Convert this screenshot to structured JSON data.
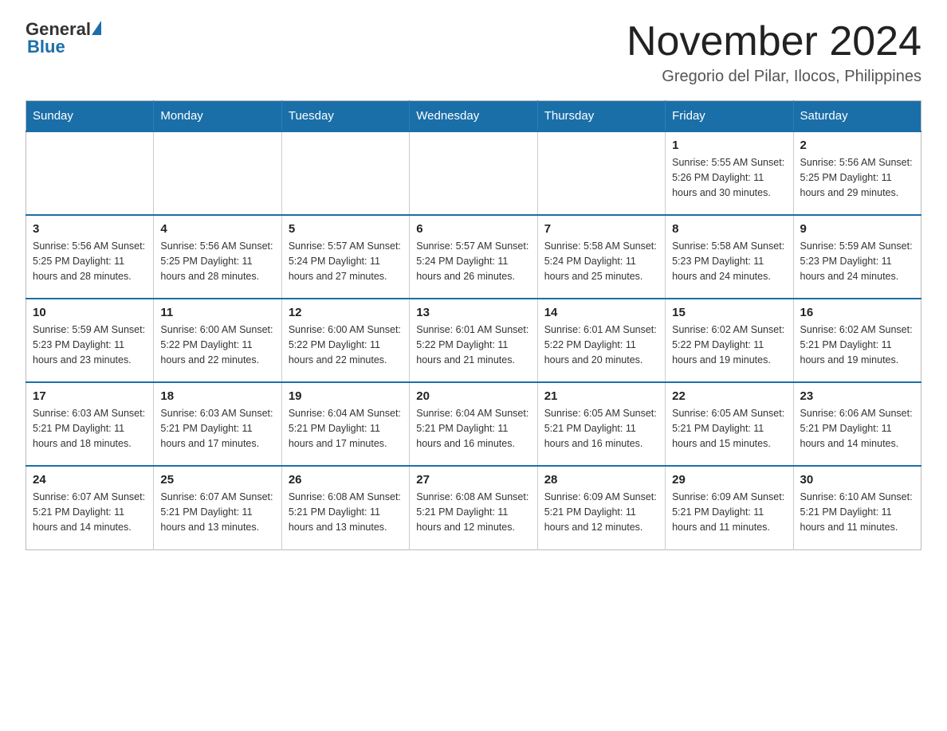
{
  "header": {
    "logo": {
      "text_general": "General",
      "triangle": "▶",
      "text_blue": "Blue"
    },
    "month_title": "November 2024",
    "subtitle": "Gregorio del Pilar, Ilocos, Philippines"
  },
  "calendar": {
    "days_of_week": [
      "Sunday",
      "Monday",
      "Tuesday",
      "Wednesday",
      "Thursday",
      "Friday",
      "Saturday"
    ],
    "weeks": [
      [
        {
          "day": "",
          "info": ""
        },
        {
          "day": "",
          "info": ""
        },
        {
          "day": "",
          "info": ""
        },
        {
          "day": "",
          "info": ""
        },
        {
          "day": "",
          "info": ""
        },
        {
          "day": "1",
          "info": "Sunrise: 5:55 AM\nSunset: 5:26 PM\nDaylight: 11 hours\nand 30 minutes."
        },
        {
          "day": "2",
          "info": "Sunrise: 5:56 AM\nSunset: 5:25 PM\nDaylight: 11 hours\nand 29 minutes."
        }
      ],
      [
        {
          "day": "3",
          "info": "Sunrise: 5:56 AM\nSunset: 5:25 PM\nDaylight: 11 hours\nand 28 minutes."
        },
        {
          "day": "4",
          "info": "Sunrise: 5:56 AM\nSunset: 5:25 PM\nDaylight: 11 hours\nand 28 minutes."
        },
        {
          "day": "5",
          "info": "Sunrise: 5:57 AM\nSunset: 5:24 PM\nDaylight: 11 hours\nand 27 minutes."
        },
        {
          "day": "6",
          "info": "Sunrise: 5:57 AM\nSunset: 5:24 PM\nDaylight: 11 hours\nand 26 minutes."
        },
        {
          "day": "7",
          "info": "Sunrise: 5:58 AM\nSunset: 5:24 PM\nDaylight: 11 hours\nand 25 minutes."
        },
        {
          "day": "8",
          "info": "Sunrise: 5:58 AM\nSunset: 5:23 PM\nDaylight: 11 hours\nand 24 minutes."
        },
        {
          "day": "9",
          "info": "Sunrise: 5:59 AM\nSunset: 5:23 PM\nDaylight: 11 hours\nand 24 minutes."
        }
      ],
      [
        {
          "day": "10",
          "info": "Sunrise: 5:59 AM\nSunset: 5:23 PM\nDaylight: 11 hours\nand 23 minutes."
        },
        {
          "day": "11",
          "info": "Sunrise: 6:00 AM\nSunset: 5:22 PM\nDaylight: 11 hours\nand 22 minutes."
        },
        {
          "day": "12",
          "info": "Sunrise: 6:00 AM\nSunset: 5:22 PM\nDaylight: 11 hours\nand 22 minutes."
        },
        {
          "day": "13",
          "info": "Sunrise: 6:01 AM\nSunset: 5:22 PM\nDaylight: 11 hours\nand 21 minutes."
        },
        {
          "day": "14",
          "info": "Sunrise: 6:01 AM\nSunset: 5:22 PM\nDaylight: 11 hours\nand 20 minutes."
        },
        {
          "day": "15",
          "info": "Sunrise: 6:02 AM\nSunset: 5:22 PM\nDaylight: 11 hours\nand 19 minutes."
        },
        {
          "day": "16",
          "info": "Sunrise: 6:02 AM\nSunset: 5:21 PM\nDaylight: 11 hours\nand 19 minutes."
        }
      ],
      [
        {
          "day": "17",
          "info": "Sunrise: 6:03 AM\nSunset: 5:21 PM\nDaylight: 11 hours\nand 18 minutes."
        },
        {
          "day": "18",
          "info": "Sunrise: 6:03 AM\nSunset: 5:21 PM\nDaylight: 11 hours\nand 17 minutes."
        },
        {
          "day": "19",
          "info": "Sunrise: 6:04 AM\nSunset: 5:21 PM\nDaylight: 11 hours\nand 17 minutes."
        },
        {
          "day": "20",
          "info": "Sunrise: 6:04 AM\nSunset: 5:21 PM\nDaylight: 11 hours\nand 16 minutes."
        },
        {
          "day": "21",
          "info": "Sunrise: 6:05 AM\nSunset: 5:21 PM\nDaylight: 11 hours\nand 16 minutes."
        },
        {
          "day": "22",
          "info": "Sunrise: 6:05 AM\nSunset: 5:21 PM\nDaylight: 11 hours\nand 15 minutes."
        },
        {
          "day": "23",
          "info": "Sunrise: 6:06 AM\nSunset: 5:21 PM\nDaylight: 11 hours\nand 14 minutes."
        }
      ],
      [
        {
          "day": "24",
          "info": "Sunrise: 6:07 AM\nSunset: 5:21 PM\nDaylight: 11 hours\nand 14 minutes."
        },
        {
          "day": "25",
          "info": "Sunrise: 6:07 AM\nSunset: 5:21 PM\nDaylight: 11 hours\nand 13 minutes."
        },
        {
          "day": "26",
          "info": "Sunrise: 6:08 AM\nSunset: 5:21 PM\nDaylight: 11 hours\nand 13 minutes."
        },
        {
          "day": "27",
          "info": "Sunrise: 6:08 AM\nSunset: 5:21 PM\nDaylight: 11 hours\nand 12 minutes."
        },
        {
          "day": "28",
          "info": "Sunrise: 6:09 AM\nSunset: 5:21 PM\nDaylight: 11 hours\nand 12 minutes."
        },
        {
          "day": "29",
          "info": "Sunrise: 6:09 AM\nSunset: 5:21 PM\nDaylight: 11 hours\nand 11 minutes."
        },
        {
          "day": "30",
          "info": "Sunrise: 6:10 AM\nSunset: 5:21 PM\nDaylight: 11 hours\nand 11 minutes."
        }
      ]
    ]
  }
}
